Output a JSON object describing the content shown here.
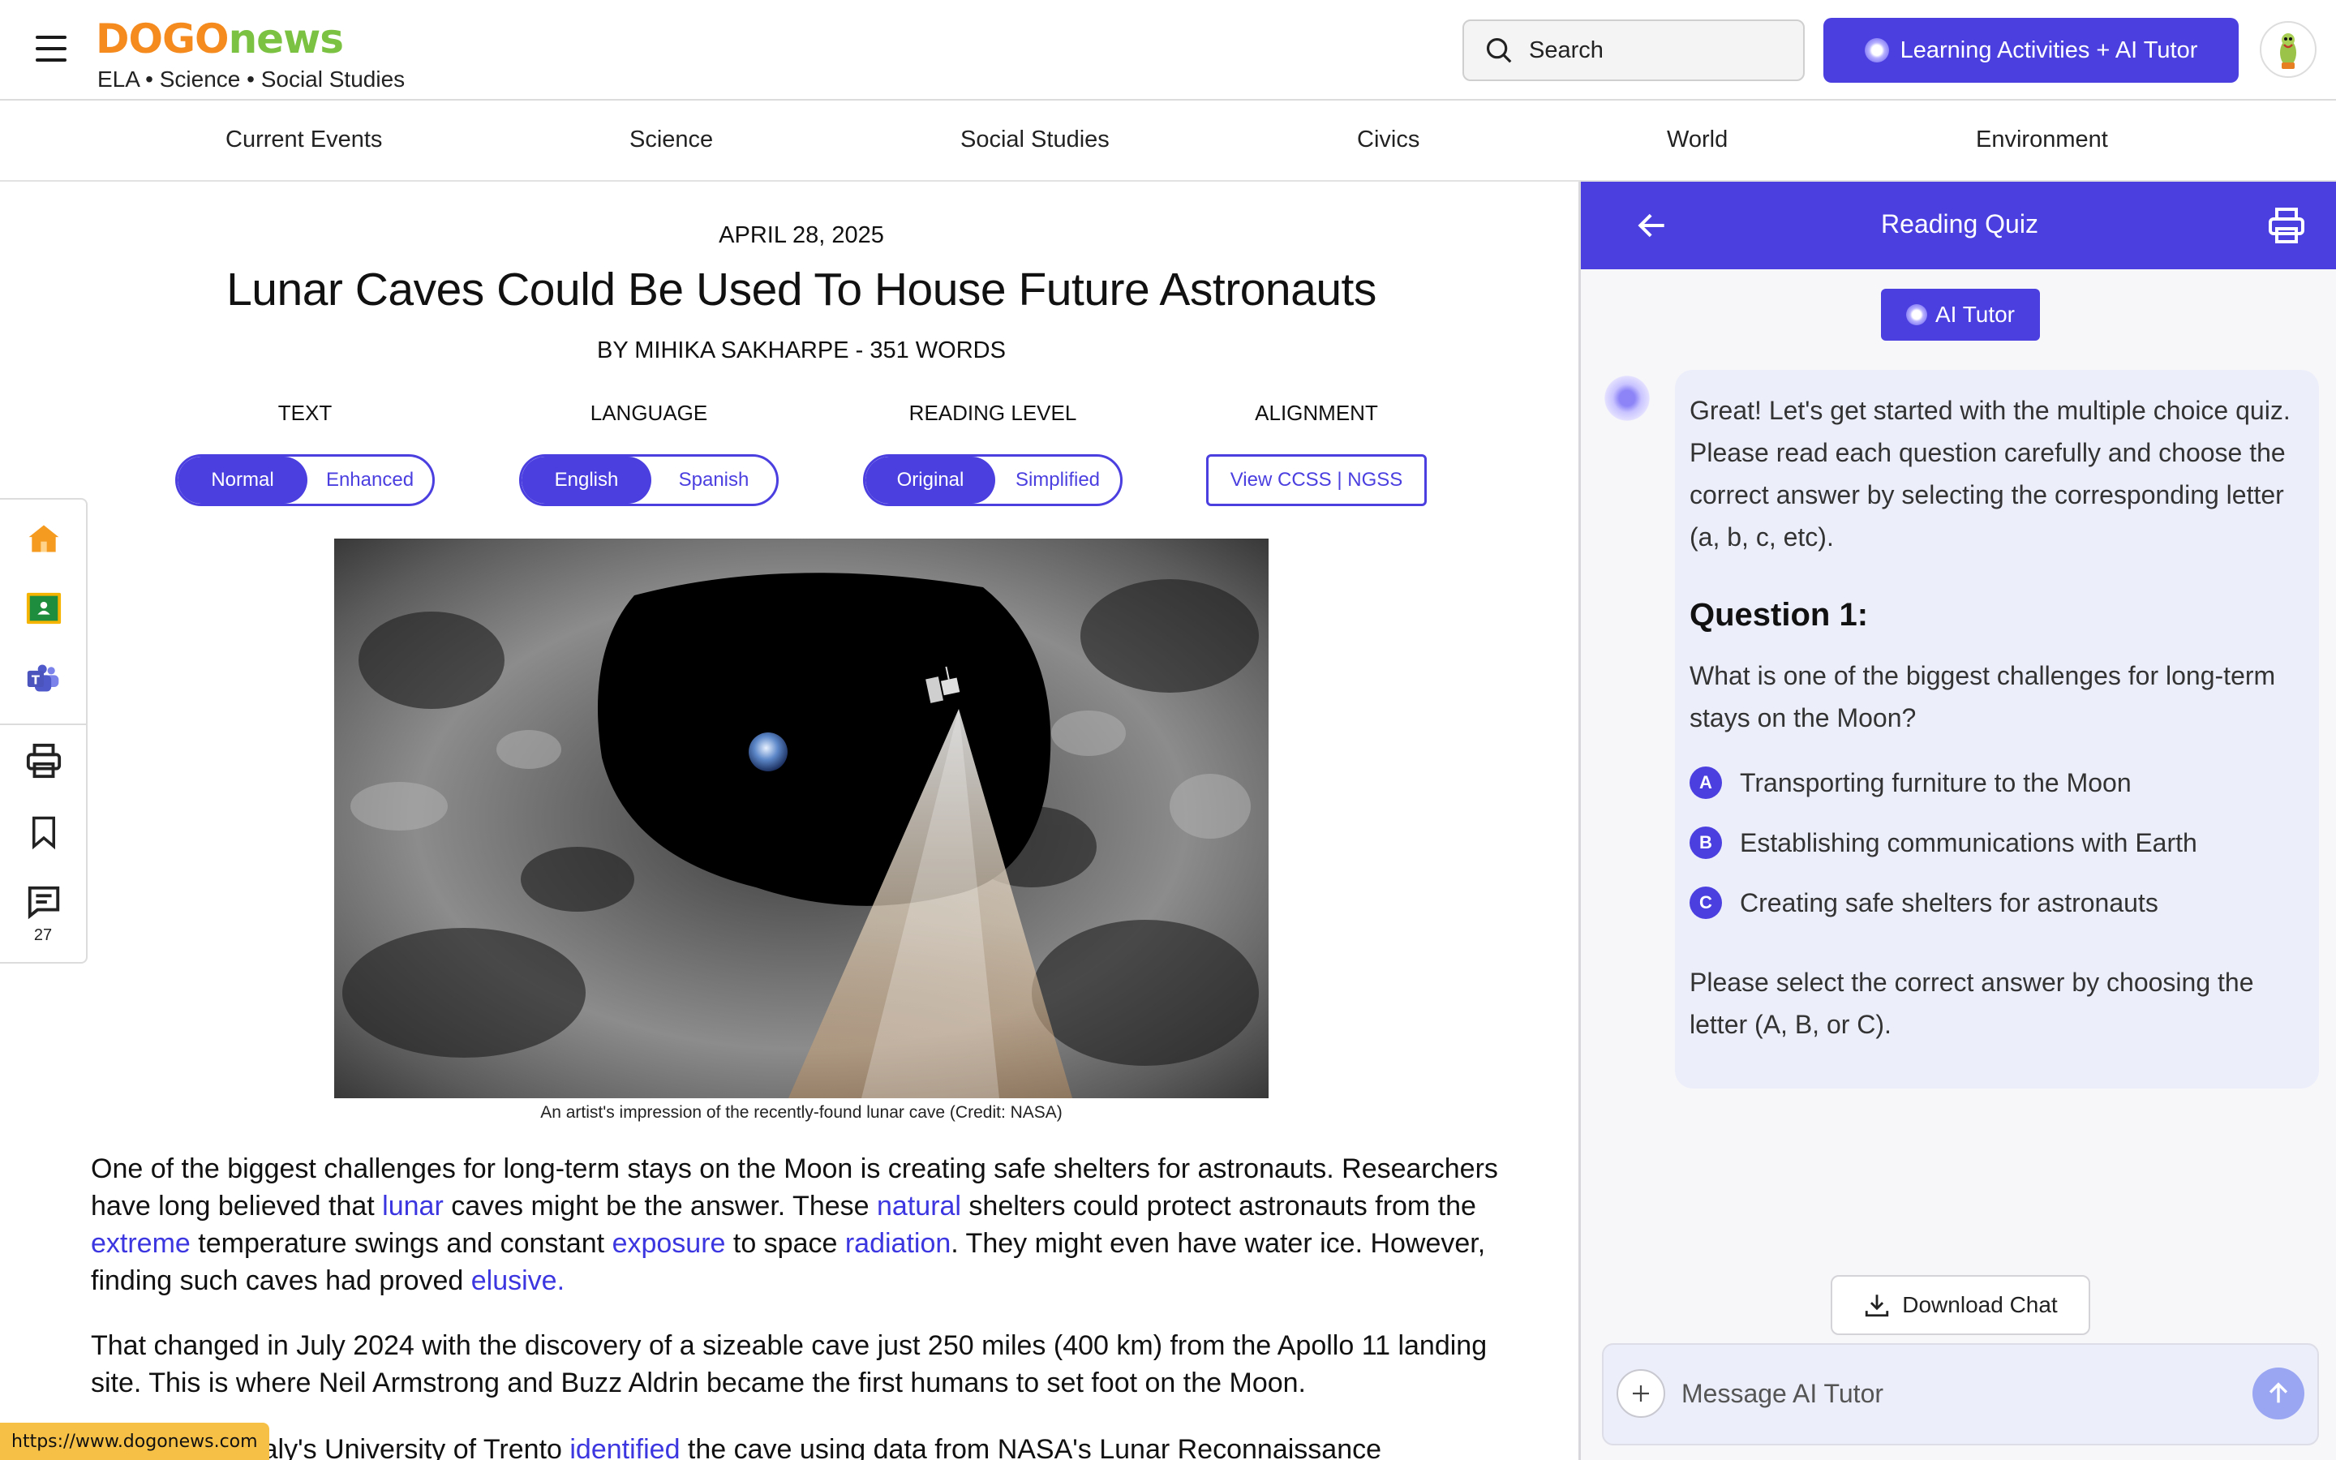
{
  "header": {
    "logo_part1": "DOGO",
    "logo_part2": "news",
    "tagline": "ELA • Science • Social Studies",
    "search_placeholder": "Search",
    "learning_button": "Learning Activities + AI Tutor"
  },
  "nav": [
    "Current Events",
    "Science",
    "Social Studies",
    "Civics",
    "World",
    "Environment"
  ],
  "article": {
    "date": "APRIL 28, 2025",
    "title": "Lunar Caves Could Be Used To House Future Astronauts",
    "byline": "BY MIHIKA SAKHARPE - 351 WORDS",
    "controls": {
      "text": {
        "label": "TEXT",
        "options": [
          "Normal",
          "Enhanced"
        ],
        "selected": "Normal"
      },
      "language": {
        "label": "LANGUAGE",
        "options": [
          "English",
          "Spanish"
        ],
        "selected": "English"
      },
      "reading_level": {
        "label": "READING LEVEL",
        "options": [
          "Original",
          "Simplified"
        ],
        "selected": "Original"
      },
      "alignment": {
        "label": "ALIGNMENT",
        "button": "View CCSS | NGSS"
      }
    },
    "image_caption": "An artist's impression of the recently-found lunar cave (Credit: NASA)",
    "p1": {
      "t1": "One of the biggest challenges for long-term stays on the Moon is creating safe shelters for astronauts. Researchers have long believed that ",
      "l1": "lunar",
      "t2": " caves might be the answer. These ",
      "l2": "natural",
      "t3": " shelters could protect astronauts from the ",
      "l3": "extreme",
      "t4": " temperature swings and constant ",
      "l4": "exposure",
      "t5": " to space ",
      "l5": "radiation",
      "t6": ". They might even have water ice. However, finding such caves had proved ",
      "l6": "elusive."
    },
    "p2": "That changed in July 2024 with the discovery of a sizeable cave just 250 miles (400 km) from the Apollo 11 landing site. This is where Neil Armstrong and Buzz Aldrin became the first humans to set foot on the Moon.",
    "p3": {
      "t1": "Scientists at Italy's University of Trento ",
      "l1": "identified",
      "t2": " the cave using data from NASA's Lunar Reconnaissance"
    }
  },
  "rail": {
    "tools": [
      "home-icon",
      "google-classroom-icon",
      "teams-icon",
      "print-icon",
      "bookmark-icon",
      "comments-icon"
    ],
    "comment_count": "27"
  },
  "panel": {
    "title": "Reading Quiz",
    "tutor_button": "AI Tutor",
    "message": {
      "intro": "Great! Let's get started with the multiple choice quiz. Please read each question carefully and choose the correct answer by selecting the corresponding letter (a, b, c, etc).",
      "question_heading": "Question 1:",
      "question": "What is one of the biggest challenges for long-term stays on the Moon?",
      "answers": [
        {
          "letter": "A",
          "text": "Transporting furniture to the Moon"
        },
        {
          "letter": "B",
          "text": "Establishing communications with Earth"
        },
        {
          "letter": "C",
          "text": "Creating safe shelters for astronauts"
        }
      ],
      "outro": "Please select the correct answer by choosing the letter (A, B, or C)."
    },
    "download_button": "Download Chat",
    "composer_placeholder": "Message AI Tutor"
  },
  "status_url": "https://www.dogonews.com",
  "colors": {
    "accent": "#4b3fe0",
    "logo_orange": "#f58a1f",
    "logo_green": "#7cc242",
    "link": "#3b36e0"
  }
}
